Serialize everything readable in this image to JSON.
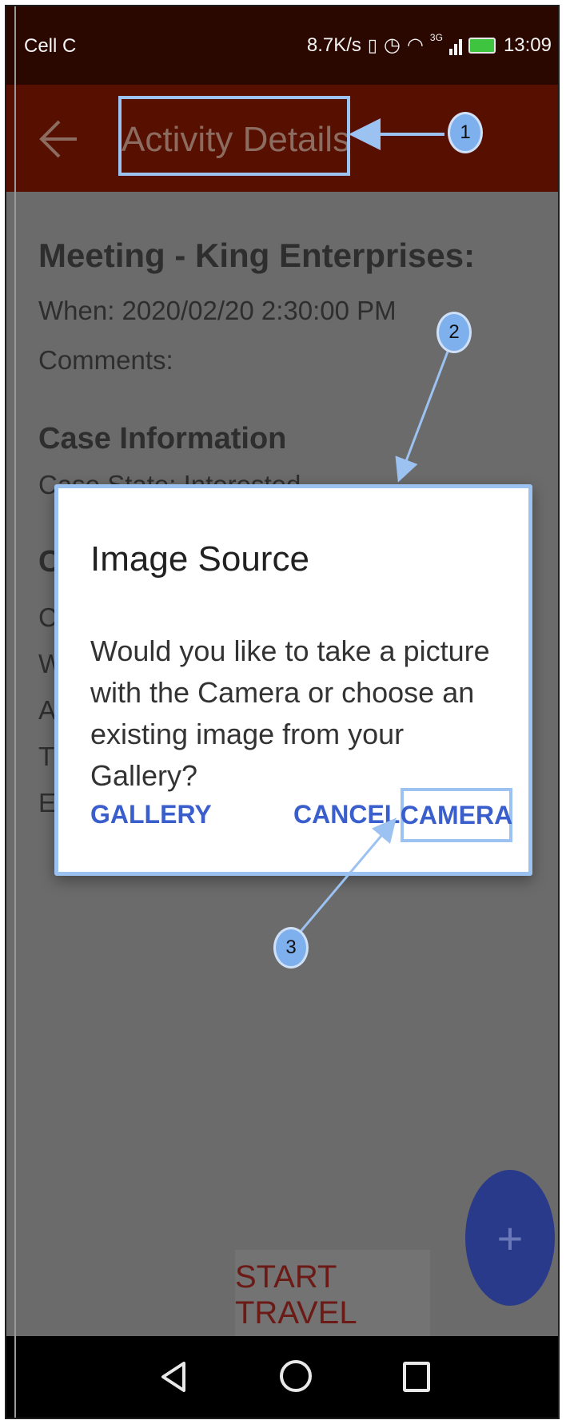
{
  "status_bar": {
    "carrier": "Cell C",
    "speed": "8.7K/s",
    "network": "3G",
    "time": "13:09"
  },
  "toolbar": {
    "title": "Activity Details"
  },
  "content": {
    "activity_title": "Meeting - King Enterprises:",
    "when": "When: 2020/02/20 2:30:00 PM",
    "comments": "Comments:",
    "case_heading": "Case Information",
    "case_state": "Case State: Interested",
    "partial_c": "C",
    "partial_lines": [
      "C",
      "W",
      "A",
      "T",
      "E"
    ]
  },
  "dialog": {
    "title": "Image Source",
    "message": "Would you like to take a picture with the Camera or choose an existing image from your Gallery?",
    "gallery_label": "GALLERY",
    "cancel_label": "CANCEL",
    "camera_label": "CAMERA"
  },
  "annotations": {
    "markers": [
      "1",
      "2",
      "3"
    ],
    "color": "#9cc2f2"
  },
  "fab": {
    "icon": "plus-icon",
    "label": "+"
  },
  "travel_button": {
    "label": "START TRAVEL"
  },
  "nav_bar": {
    "icons": [
      "back-triangle-icon",
      "home-circle-icon",
      "recents-square-icon"
    ]
  },
  "colors": {
    "toolbar": "#571000",
    "status_bar": "#2a0800",
    "scrim": "#6b6b6b",
    "accent_button": "#3a5fcd",
    "annotation": "#9cc2f2"
  }
}
